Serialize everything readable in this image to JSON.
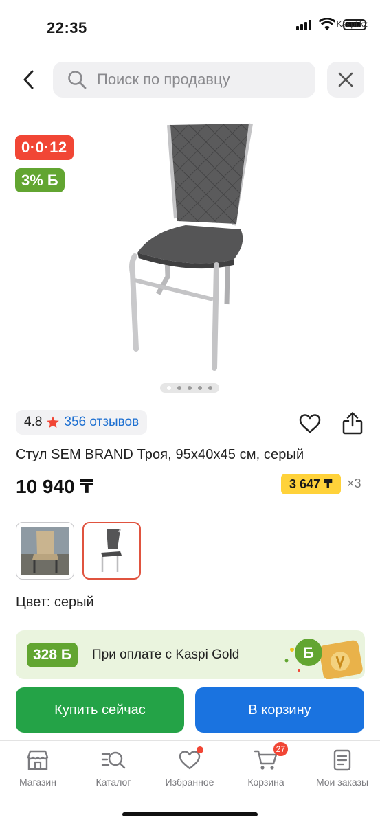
{
  "status_bar": {
    "time": "22:35",
    "carrier": "Kaspi.kz"
  },
  "search": {
    "placeholder": "Поиск по продавцу"
  },
  "badges": {
    "installment": "0·0·12",
    "bonus": "3% Б"
  },
  "gallery": {
    "total_images": 5,
    "active_index": 0
  },
  "product": {
    "rating": "4.8",
    "reviews": "356 отзывов",
    "title": "Стул SEM BRAND Троя, 95x40x45 см, серый",
    "price": "10 940 ₸",
    "monthly_payment": "3 647 ₸",
    "monthly_multiplier": "×3",
    "color_label": "Цвет: серый"
  },
  "colors": {
    "options": [
      "beige",
      "gray"
    ],
    "selected": "gray"
  },
  "kaspi_gold": {
    "bonus_amount": "328 Б",
    "text": "При оплате с Kaspi Gold"
  },
  "actions": {
    "buy_now": "Купить сейчас",
    "add_to_cart": "В корзину"
  },
  "nav": {
    "items": [
      {
        "label": "Магазин",
        "icon": "shop-icon"
      },
      {
        "label": "Каталог",
        "icon": "catalog-search-icon"
      },
      {
        "label": "Избранное",
        "icon": "heart-icon"
      },
      {
        "label": "Корзина",
        "icon": "cart-icon"
      },
      {
        "label": "Мои заказы",
        "icon": "orders-icon"
      }
    ],
    "cart_count": "27"
  },
  "colors_theme": {
    "red": "#f14635",
    "green": "#62a531",
    "buy_green": "#24a347",
    "blue": "#1a73e0",
    "yellow": "#ffd23a"
  }
}
